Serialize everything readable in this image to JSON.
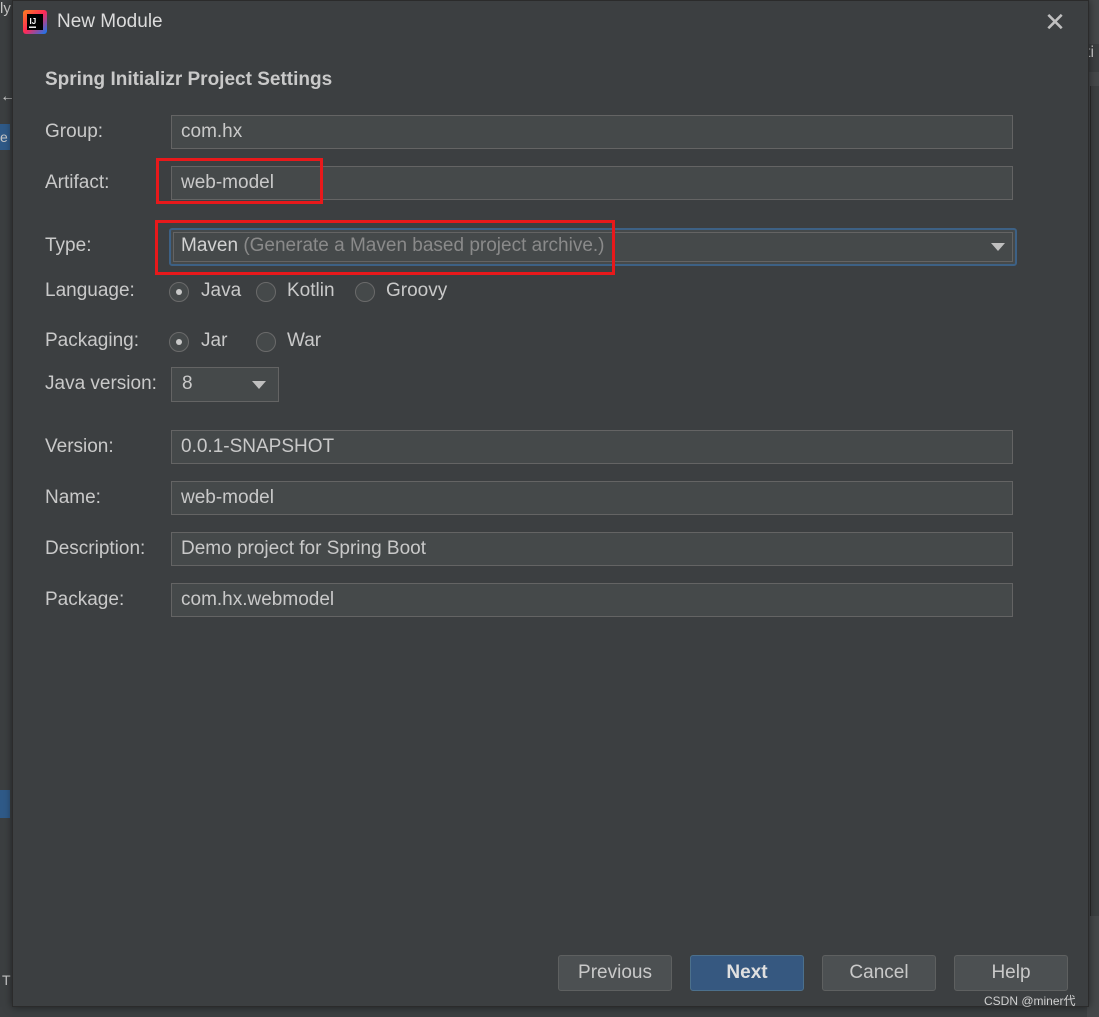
{
  "background": {
    "left_top_text": "ly",
    "left_arrow_icon": "arrow-left-icon",
    "left_blue_text": "e",
    "left_bottom_text": "T",
    "right_tab_text": "ti"
  },
  "dialog": {
    "title": "New Module",
    "app_icon": "intellij-idea-icon",
    "close_icon": "close-icon",
    "section_title": "Spring Initializr Project Settings"
  },
  "form": {
    "group": {
      "label": "Group:",
      "value": "com.hx"
    },
    "artifact": {
      "label": "Artifact:",
      "value": "web-model"
    },
    "type": {
      "label": "Type:",
      "value": "Maven",
      "hint": "(Generate a Maven based project archive.)"
    },
    "language": {
      "label": "Language:",
      "options": [
        {
          "label": "Java",
          "checked": true
        },
        {
          "label": "Kotlin",
          "checked": false
        },
        {
          "label": "Groovy",
          "checked": false
        }
      ]
    },
    "packaging": {
      "label": "Packaging:",
      "options": [
        {
          "label": "Jar",
          "checked": true
        },
        {
          "label": "War",
          "checked": false
        }
      ]
    },
    "java_version": {
      "label": "Java version:",
      "value": "8"
    },
    "version": {
      "label": "Version:",
      "value": "0.0.1-SNAPSHOT"
    },
    "name": {
      "label": "Name:",
      "value": "web-model"
    },
    "description": {
      "label": "Description:",
      "value": "Demo project for Spring Boot"
    },
    "package": {
      "label": "Package:",
      "value": "com.hx.webmodel"
    }
  },
  "buttons": {
    "previous": "Previous",
    "next": "Next",
    "cancel": "Cancel",
    "help": "Help"
  },
  "colors": {
    "dialog_bg": "#3c3f41",
    "field_bg": "#45494a",
    "primary_button": "#365880",
    "highlight_red": "#e8191b"
  },
  "watermark": "CSDN @miner代"
}
